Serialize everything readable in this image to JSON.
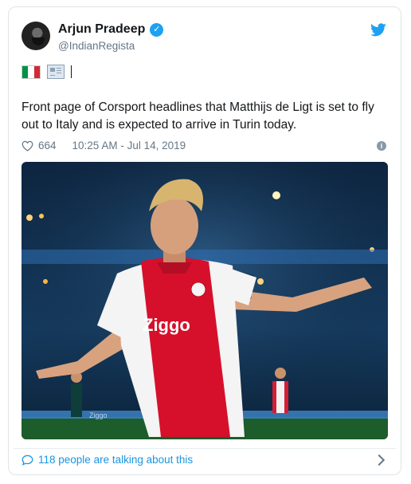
{
  "author": {
    "display_name": "Arjun Pradeep",
    "handle": "@IndianRegista",
    "verified": true
  },
  "header_line": {
    "flag_icon": "italy-flag-icon",
    "newspaper_icon": "newspaper-icon",
    "separator": "|"
  },
  "tweet": {
    "text": "Front page of Corsport headlines that Matthijs de Ligt is set to fly out to Italy and is expected to arrive in Turin today.",
    "like_count": "664",
    "timestamp": "10:25 AM - Jul 14, 2019"
  },
  "media": {
    "shirt_sponsor": "Ziggo",
    "board_text": "Ziggo"
  },
  "footer": {
    "talking_text": "118 people are talking about this"
  },
  "colors": {
    "twitter_blue": "#1da1f2",
    "link_blue": "#1b95e0",
    "muted_gray": "#657786"
  }
}
